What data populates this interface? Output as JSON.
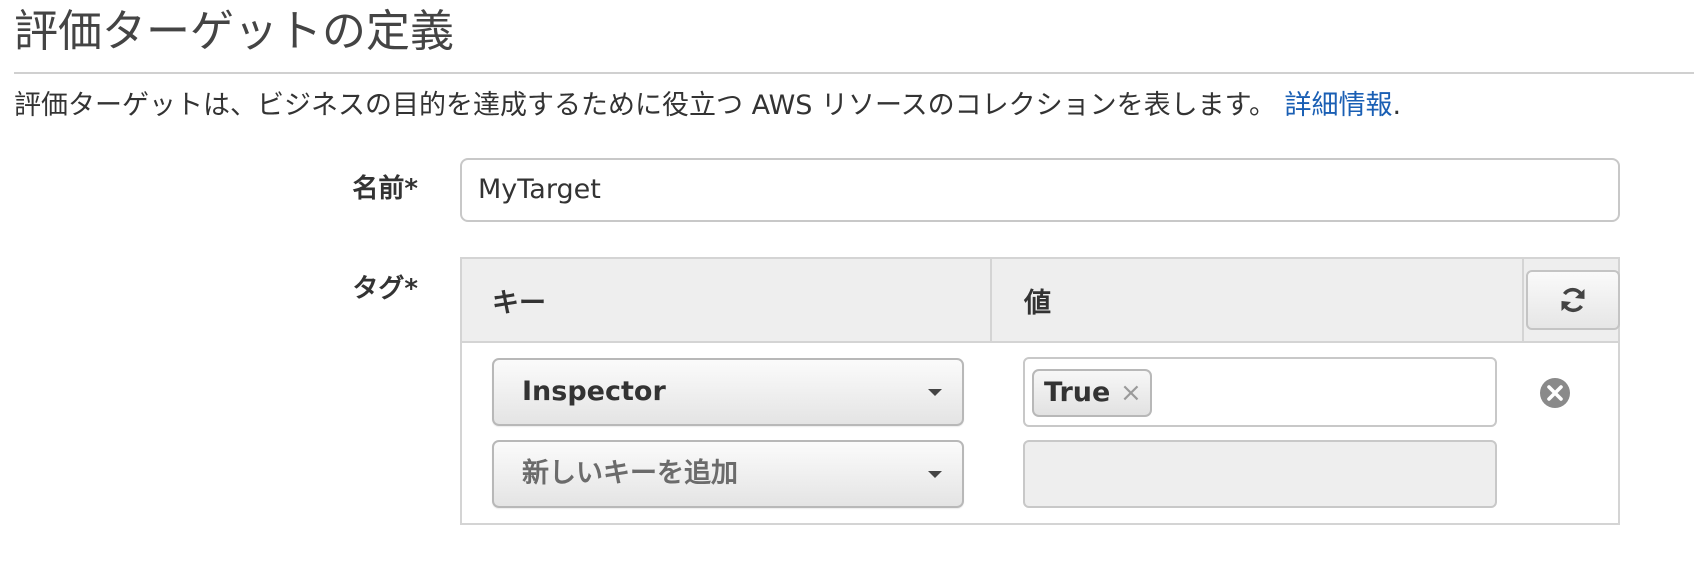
{
  "page": {
    "title": "評価ターゲットの定義",
    "description": "評価ターゲットは、ビジネスの目的を達成するために役立つ AWS リソースのコレクションを表します。",
    "learn_more_link": "詳細情報",
    "link_suffix": "."
  },
  "name_field": {
    "label": "名前*",
    "value": "MyTarget"
  },
  "tags": {
    "label": "タグ*",
    "columns": {
      "key": "キー",
      "value": "値"
    },
    "refresh_icon": "refresh-icon",
    "rows": [
      {
        "key": "Inspector",
        "value_token": "True",
        "token_remove_glyph": "×"
      }
    ],
    "new_row": {
      "key_placeholder": "新しいキーを追加"
    }
  },
  "colors": {
    "link": "#1a5fb4",
    "header_bg": "#eeeeee",
    "disabled_bg": "#eeeeee"
  }
}
